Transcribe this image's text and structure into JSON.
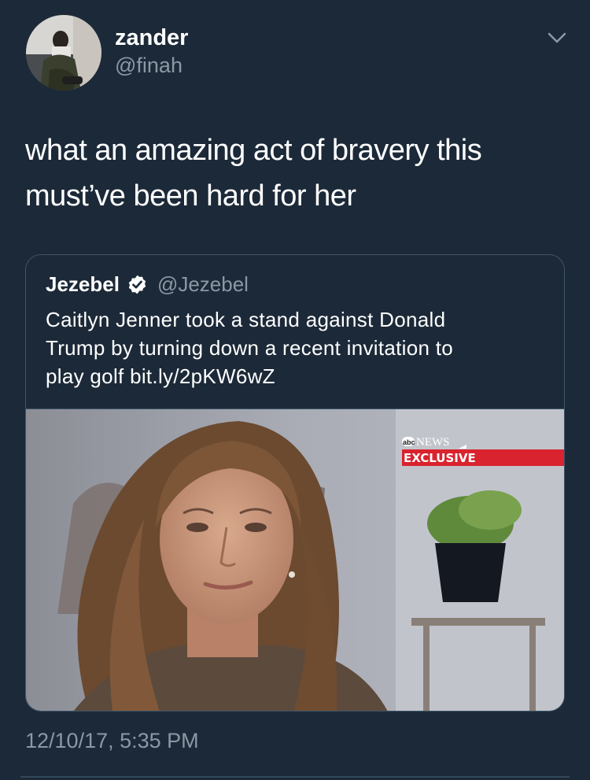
{
  "tweet": {
    "display_name": "zander",
    "handle": "@finah",
    "text_line1": "what an amazing act of bravery this",
    "text_line2": "must’ve been hard for her",
    "timestamp": "12/10/17, 5:35 PM"
  },
  "quoted_tweet": {
    "display_name": "Jezebel",
    "handle": "@Jezebel",
    "text_line1": "Caitlyn Jenner took a stand against Donald",
    "text_line2": "Trump by turning down a recent invitation to",
    "text_line3": "play golf bit.ly/2pKW6wZ",
    "media": {
      "logo_text": "NEWS",
      "logo_prefix": "abc",
      "banner_text": "EXCLUSIVE"
    }
  },
  "icons": {
    "more": "chevron-down-icon",
    "verified": "verified-badge-icon"
  },
  "colors": {
    "background": "#1c2938",
    "secondary_text": "#8b98a5",
    "verified_badge": "#ffffff",
    "banner_red": "#d9232e"
  }
}
